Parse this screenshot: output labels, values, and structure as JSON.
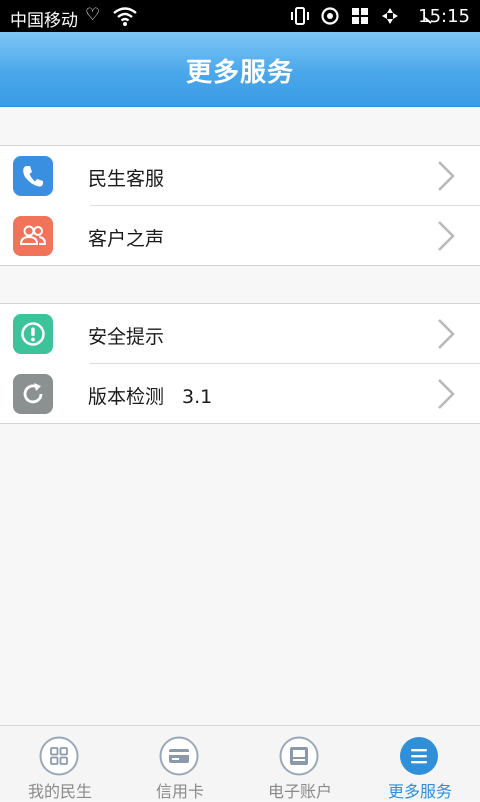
{
  "status_bar": {
    "carrier": "中国移动",
    "time": "15:15"
  },
  "header": {
    "title": "更多服务"
  },
  "groups": [
    {
      "items": [
        {
          "label": "民生客服",
          "icon": "phone-icon",
          "color": "#3a8fe0"
        },
        {
          "label": "客户之声",
          "icon": "people-icon",
          "color": "#f0735a"
        }
      ]
    },
    {
      "items": [
        {
          "label": "安全提示",
          "icon": "alert-icon",
          "color": "#3cc39a"
        },
        {
          "label": "版本检测",
          "value": "3.1",
          "icon": "refresh-icon",
          "color": "#8a9190"
        }
      ]
    }
  ],
  "tabbar": {
    "tabs": [
      {
        "label": "我的民生",
        "icon": "grid-icon",
        "active": false
      },
      {
        "label": "信用卡",
        "icon": "credit-card-icon",
        "active": false
      },
      {
        "label": "电子账户",
        "icon": "wallet-icon",
        "active": false
      },
      {
        "label": "更多服务",
        "icon": "menu-icon",
        "active": true
      }
    ],
    "active_color": "#2f8fd8"
  }
}
